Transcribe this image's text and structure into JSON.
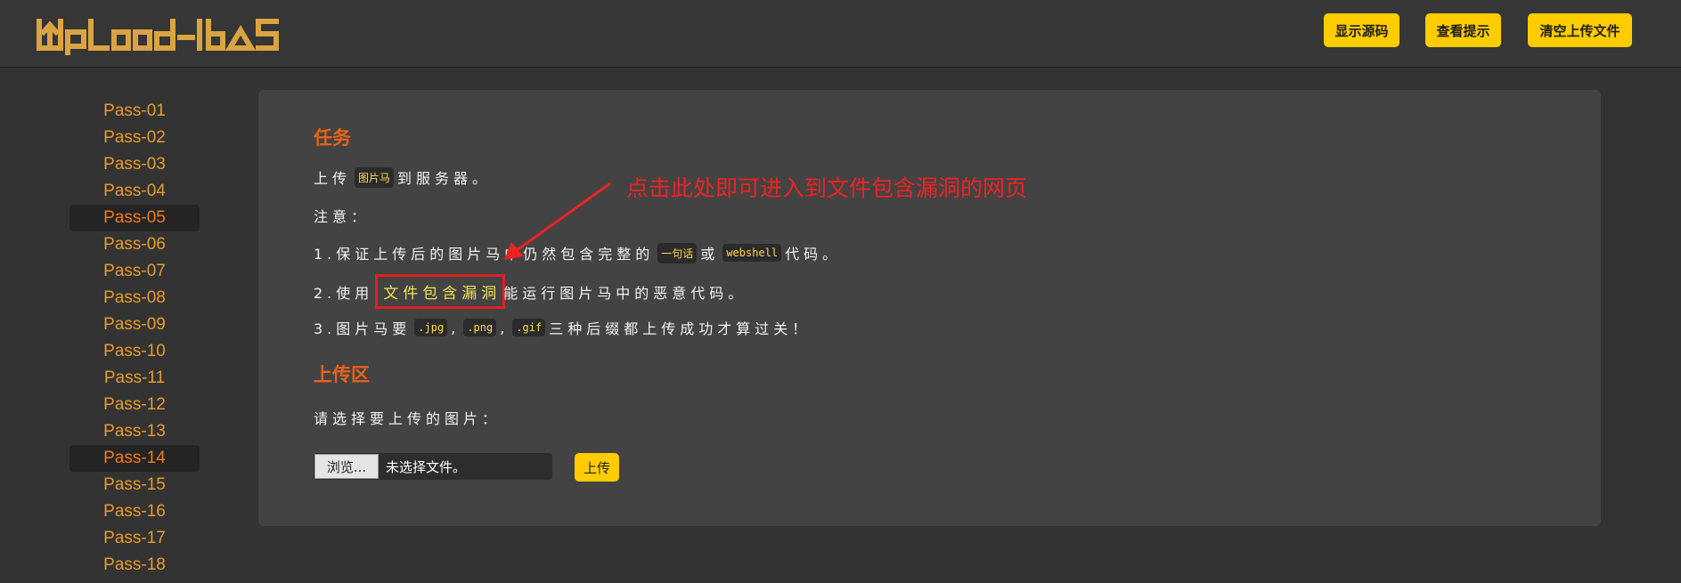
{
  "header": {
    "logo_text": "Upload-labs",
    "buttons": [
      "显示源码",
      "查看提示",
      "清空上传文件"
    ]
  },
  "sidebar": {
    "items": [
      "Pass-01",
      "Pass-02",
      "Pass-03",
      "Pass-04",
      "Pass-05",
      "Pass-06",
      "Pass-07",
      "Pass-08",
      "Pass-09",
      "Pass-10",
      "Pass-11",
      "Pass-12",
      "Pass-13",
      "Pass-14",
      "Pass-15",
      "Pass-16",
      "Pass-17",
      "Pass-18"
    ],
    "highlighted": [
      "Pass-05",
      "Pass-14"
    ]
  },
  "task": {
    "title": "任务",
    "line1_pre": "上传",
    "line1_code": "图片马",
    "line1_post": "到服务器。",
    "note": "注意：",
    "item1_pre": "1.保证上传后的图片马中仍然包含完整的",
    "item1_code1": "一句话",
    "item1_mid": "或",
    "item1_code2": "webshell",
    "item1_post": "代码。",
    "item2_pre": "2.使用",
    "item2_link": "文件包含漏洞",
    "item2_post": "能运行图片马中的恶意代码。",
    "item3_pre": "3.图片马要",
    "item3_code1": ".jpg",
    "item3_sep1": ",",
    "item3_code2": ".png",
    "item3_sep2": ",",
    "item3_code3": ".gif",
    "item3_post": "三种后缀都上传成功才算过关！"
  },
  "upload": {
    "title": "上传区",
    "prompt": "请选择要上传的图片：",
    "browse_label": "浏览...",
    "file_status": "未选择文件。",
    "submit_label": "上传"
  },
  "annotation": {
    "text": "点击此处即可进入到文件包含漏洞的网页",
    "color": "#ee2222"
  },
  "colors": {
    "accent": "#ffcc00",
    "section_title": "#e8611a",
    "sidebar_link": "#e79b2d"
  }
}
